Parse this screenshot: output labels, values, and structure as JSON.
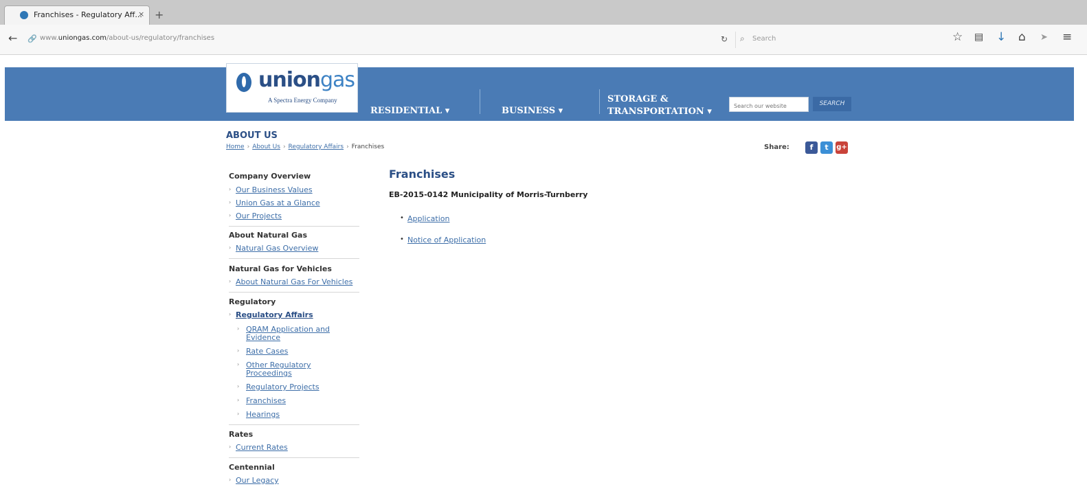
{
  "browser": {
    "tab_title": "Franchises - Regulatory Aff...",
    "tab_close": "×",
    "new_tab": "+",
    "url_prefix": "www.",
    "url_domain": "uniongas.com",
    "url_path": "/about-us/regulatory/franchises",
    "search_placeholder": "Search"
  },
  "logo": {
    "name_bold": "union",
    "name_light": "gas",
    "tagline": "A Spectra Energy Company"
  },
  "main_nav": {
    "residential": "RESIDENTIAL ▾",
    "business": "BUSINESS ▾",
    "storage_line1": "STORAGE &",
    "storage_line2": "TRANSPORTATION ▾",
    "search_placeholder": "Search our website",
    "search_button": "SEARCH"
  },
  "content_header": {
    "section": "ABOUT US",
    "breadcrumb": [
      "Home",
      "About Us",
      "Regulatory Affairs",
      "Franchises"
    ],
    "share_label": "Share:"
  },
  "sidebar": {
    "company_overview": {
      "title": "Company Overview",
      "items": [
        "Our Business Values",
        "Union Gas at a Glance",
        "Our Projects"
      ]
    },
    "about_natural_gas": {
      "title": "About Natural Gas",
      "items": [
        "Natural Gas Overview"
      ]
    },
    "ngv": {
      "title": "Natural Gas for Vehicles",
      "items": [
        "About Natural Gas For Vehicles"
      ]
    },
    "regulatory": {
      "title": "Regulatory",
      "active": "Regulatory Affairs",
      "sub_items": [
        "QRAM Application and Evidence",
        "Rate Cases",
        "Other Regulatory Proceedings",
        "Regulatory Projects",
        "Franchises",
        "Hearings"
      ]
    },
    "rates": {
      "title": "Rates",
      "items": [
        "Current Rates"
      ]
    },
    "centennial": {
      "title": "Centennial",
      "items": [
        "Our Legacy"
      ]
    }
  },
  "main": {
    "title": "Franchises",
    "case_heading": "EB-2015-0142 Municipality of Morris-Turnberry",
    "documents": [
      "Application",
      "Notice of Application"
    ]
  },
  "colors": {
    "header_blue": "#4a7bb5",
    "brand_navy": "#2b4f86",
    "link_blue": "#3d6ea8",
    "facebook": "#3b5998",
    "twitter": "#1da1f2",
    "google_plus": "#c9433a"
  }
}
